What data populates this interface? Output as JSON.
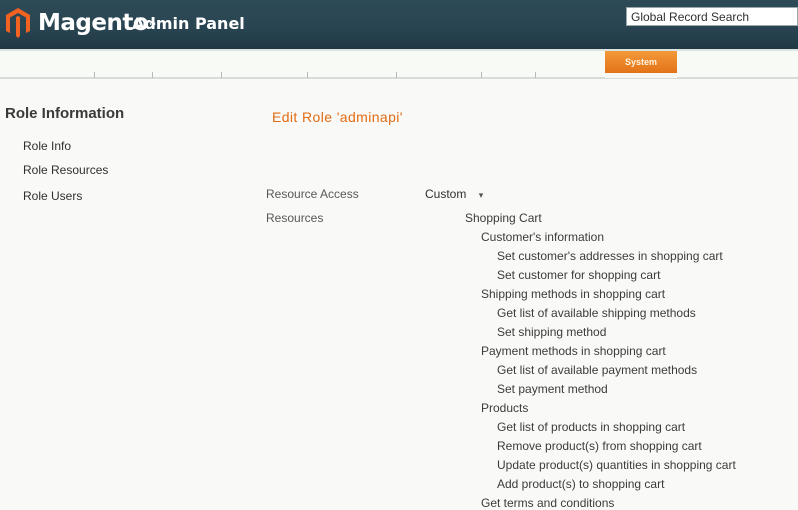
{
  "header": {
    "logo_text": "Magento",
    "logo_tm": "™",
    "logo_subtitle": "Admin Panel",
    "search_value": "Global Record Search"
  },
  "nav": {
    "active_tab_label": "System"
  },
  "sidebar": {
    "title": "Role Information",
    "items": [
      {
        "label": "Role Info"
      },
      {
        "label": "Role Resources"
      },
      {
        "label": "Role Users"
      }
    ]
  },
  "main": {
    "title": "Edit Role 'adminapi'",
    "resource_access_label": "Resource Access",
    "resource_access_value": "Custom",
    "resources_label": "Resources",
    "tree": [
      {
        "label": "Shopping Cart"
      },
      {
        "label": "Customer's information"
      },
      {
        "label": "Set customer's addresses in shopping cart"
      },
      {
        "label": "Set customer for shopping cart"
      },
      {
        "label": "Shipping methods in shopping cart"
      },
      {
        "label": "Get list of available shipping methods"
      },
      {
        "label": "Set shipping method"
      },
      {
        "label": "Payment methods in shopping cart"
      },
      {
        "label": "Get list of available payment methods"
      },
      {
        "label": "Set payment method"
      },
      {
        "label": "Products"
      },
      {
        "label": "Get list of products in shopping cart"
      },
      {
        "label": "Remove product(s) from shopping cart"
      },
      {
        "label": "Update product(s) quantities in shopping cart"
      },
      {
        "label": "Add product(s) to shopping cart"
      },
      {
        "label": "Get terms and conditions"
      }
    ]
  },
  "colors": {
    "header_bg": "#2a4552",
    "accent_orange": "#e26b13",
    "active_tab": "#eb7d22"
  }
}
